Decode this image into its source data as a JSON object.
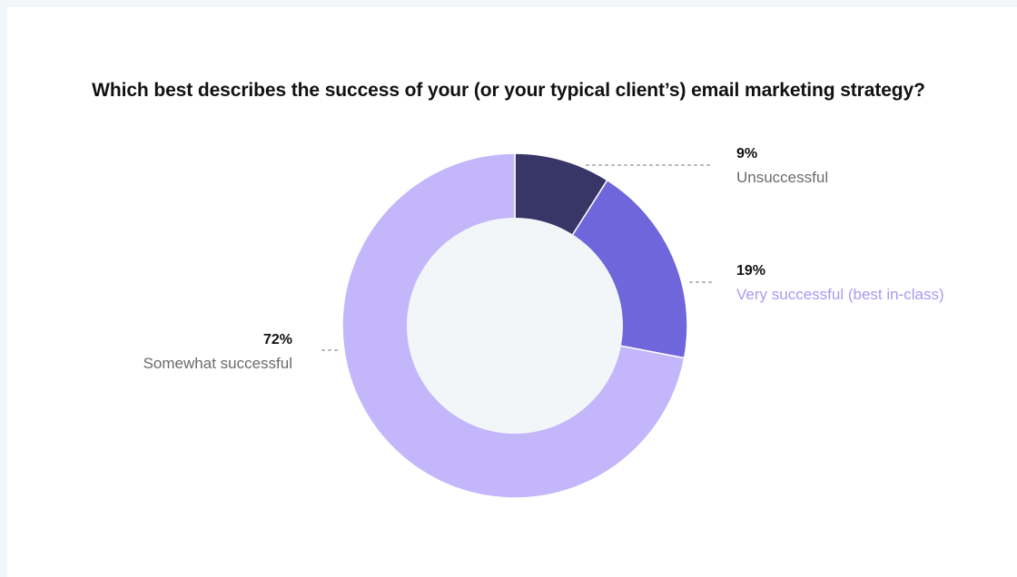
{
  "chart_data": {
    "type": "pie",
    "title": "Which best describes the success of your (or your typical client’s) email marketing strategy?",
    "slices": [
      {
        "label": "Unsuccessful",
        "value": 9,
        "value_label": "9%",
        "color": "#383567",
        "label_color": "#6b6b6b"
      },
      {
        "label": "Very successful (best in-class)",
        "value": 19,
        "value_label": "19%",
        "color": "#6e66da",
        "label_color": "#a99bf0"
      },
      {
        "label": "Somewhat successful",
        "value": 72,
        "value_label": "72%",
        "color": "#c3b6fa",
        "label_color": "#6b6b6b"
      }
    ],
    "center_color": "#f3f6f9",
    "leader_color": "#b5b5b5"
  }
}
